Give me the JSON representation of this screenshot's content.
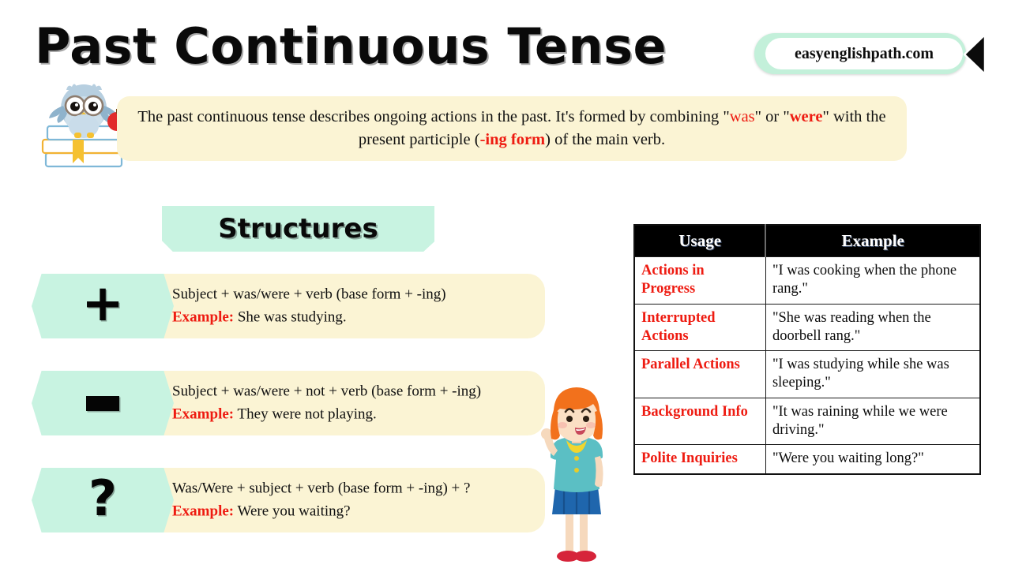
{
  "title": "Past Continuous Tense",
  "brand": {
    "text": "easyenglishpath.com",
    "chevron_icon": "chevron-left-icon",
    "outer_color": "#c3f0da"
  },
  "intro": {
    "part1": "The past continuous tense describes ongoing actions in the past. It's formed by combining \"",
    "was": "was",
    "part2": "\" or \"",
    "were": "were",
    "part3": "\" with the present participle (",
    "ing": "-ing form",
    "part4": ") of the main verb."
  },
  "structures": {
    "banner_label": "Structures",
    "rows": [
      {
        "symbol": "+",
        "symbol_icon": "plus-icon",
        "formula": "Subject + was/were + verb (base form + -ing)",
        "example_label": "Example:",
        "example": "She was studying."
      },
      {
        "symbol": "–",
        "symbol_icon": "minus-icon",
        "formula": "Subject + was/were + not + verb (base form + -ing)",
        "example_label": "Example:",
        "example": "They were not playing."
      },
      {
        "symbol": "?",
        "symbol_icon": "question-mark-icon",
        "formula": "Was/Were + subject + verb (base form + -ing) + ?",
        "example_label": "Example:",
        "example": "Were you waiting?"
      }
    ]
  },
  "table": {
    "headers": [
      "Usage",
      "Example"
    ],
    "rows": [
      {
        "usage": "Actions in Progress",
        "example": "\"I was cooking when the phone rang.\""
      },
      {
        "usage": "Interrupted Actions",
        "example": "\"She was reading when the doorbell rang.\""
      },
      {
        "usage": "Parallel Actions",
        "example": "\"I was studying while she was sleeping.\""
      },
      {
        "usage": "Background Info",
        "example": "\"It was raining while we were driving.\""
      },
      {
        "usage": "Polite Inquiries",
        "example": "\"Were you waiting long?\""
      }
    ]
  },
  "illustrations": {
    "owl": "owl-on-books-icon",
    "girl": "girl-pointing-icon"
  },
  "colors": {
    "mint": "#c8f3e1",
    "cream": "#fbf4d4",
    "red": "#ee1b11",
    "black": "#000000"
  }
}
